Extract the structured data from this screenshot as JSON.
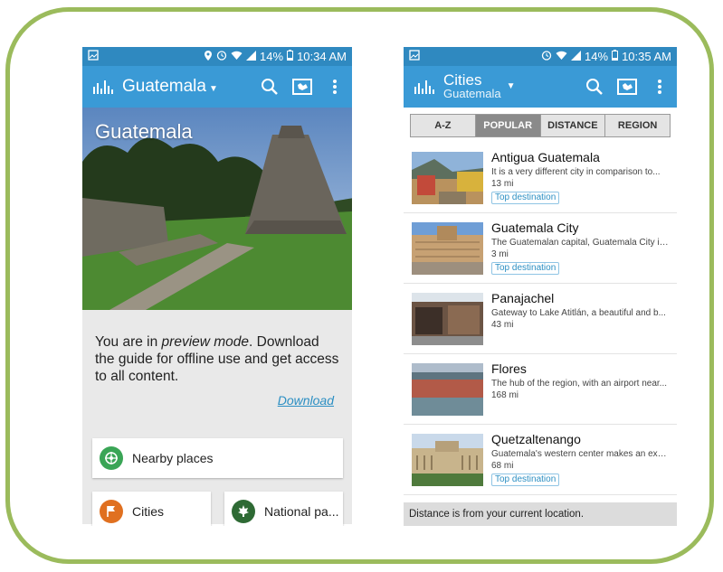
{
  "phone1": {
    "status": {
      "time": "10:34 AM",
      "battery": "14%"
    },
    "appbar": {
      "title": "Guatemala"
    },
    "hero": {
      "title": "Guatemala"
    },
    "preview": {
      "text_before": "You are in ",
      "text_em": "preview mode",
      "text_after": ". Download the guide for offline use and get access to all content.",
      "download_label": "Download"
    },
    "cards": {
      "nearby": "Nearby places",
      "cities": "Cities",
      "parks": "National pa..."
    }
  },
  "phone2": {
    "status": {
      "time": "10:35 AM",
      "battery": "14%"
    },
    "appbar": {
      "title": "Cities",
      "subtitle": "Guatemala"
    },
    "tabs": [
      "A-Z",
      "POPULAR",
      "DISTANCE",
      "REGION"
    ],
    "active_tab": "POPULAR",
    "cities": [
      {
        "name": "Antigua Guatemala",
        "desc": "It is a very different city in comparison to...",
        "dist": "13 mi",
        "badge": "Top destination"
      },
      {
        "name": "Guatemala City",
        "desc": "The Guatemalan capital, Guatemala City is...",
        "dist": "3 mi",
        "badge": "Top destination"
      },
      {
        "name": "Panajachel",
        "desc": "Gateway to Lake Atitlán, a beautiful and b...",
        "dist": "43 mi",
        "badge": ""
      },
      {
        "name": "Flores",
        "desc": "The hub of the region, with an airport near...",
        "dist": "168 mi",
        "badge": ""
      },
      {
        "name": "Quetzaltenango",
        "desc": "Guatemala's western center makes an exc...",
        "dist": "68 mi",
        "badge": "Top destination"
      }
    ],
    "footer": "Distance is from your current location."
  },
  "colors": {
    "appbar": "#3a9ad6",
    "statusbar": "#2f89c0",
    "accent_green": "#9bbb5c",
    "link": "#2c8fc3"
  },
  "icons": [
    "logo-icon",
    "search-icon",
    "map-icon",
    "overflow-menu-icon",
    "compass-icon",
    "flag-icon",
    "maple-leaf-icon",
    "location-icon",
    "alarm-icon",
    "wifi-icon",
    "signal-icon",
    "battery-icon",
    "image-icon"
  ]
}
